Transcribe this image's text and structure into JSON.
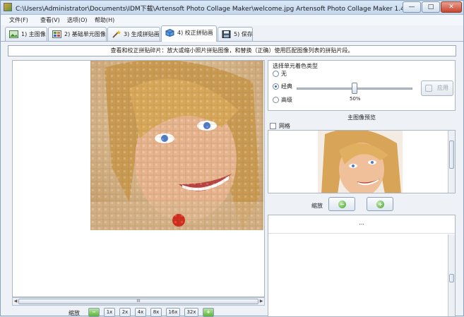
{
  "window": {
    "title": "C:\\Users\\Administrator\\Documents\\IDM下载\\Artensoft Photo Collage Maker\\welcome.jpg Artensoft Photo Collage Maker 1.4",
    "min_label": "—",
    "max_label": "□",
    "close_label": "✕"
  },
  "menu": {
    "items": [
      "文件(F)",
      "查看(V)",
      "选项(O)",
      "帮助(H)"
    ]
  },
  "tabs": [
    {
      "label": "1) 主图像",
      "icon": "main-image-icon"
    },
    {
      "label": "2) 基础单元图像",
      "icon": "cell-images-icon"
    },
    {
      "label": "3) 生成拼贴画",
      "icon": "magic-wand-icon"
    },
    {
      "label": "4) 校正拼贴画",
      "icon": "cube-icon",
      "active": true
    },
    {
      "label": "5) 保存",
      "icon": "floppy-disk-icon"
    }
  ],
  "hint": "查看和校正拼贴碎片：放大或缩小照片拼贴图像，和替换（正确）使用匹配图像列表的拼贴片段。",
  "left": {
    "scroll_grip": "III",
    "zoom_label": "缩放",
    "zoom_buttons": [
      "1x",
      "2x",
      "4x",
      "8x",
      "16x",
      "32x"
    ],
    "zoom_out_icon": "zoom-out-icon",
    "zoom_in_icon": "zoom-in-icon"
  },
  "color_type": {
    "title": "选择单元着色类型",
    "options": [
      "无",
      "经典",
      "高级"
    ],
    "selected": "经典",
    "slider_percent": 50,
    "slider_value_text": "50%",
    "apply_label": "应用"
  },
  "preview": {
    "title": "主图像预览",
    "grid_label": "网格",
    "grid_checked": false,
    "zoom_label": "缩放"
  },
  "bottom_panel": {
    "header": "..."
  },
  "colors": {
    "accent": "#2a6ac8",
    "zoom_green": "#5db43a",
    "title_bar": "#c3d6ec"
  }
}
